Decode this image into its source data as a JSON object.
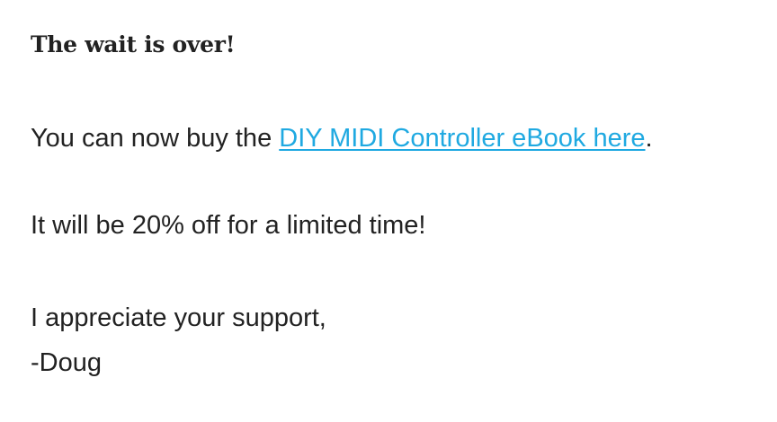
{
  "email": {
    "heading": "The wait is over!",
    "line1_prefix": "You can now buy the ",
    "line1_link": "DIY MIDI Controller eBook here",
    "line1_suffix": ".",
    "line2": "It will be 20% off for a limited time!",
    "closing": "I appreciate your support,",
    "signature": "-Doug"
  },
  "colors": {
    "text": "#222222",
    "link": "#1fa9e1",
    "background": "#ffffff"
  }
}
